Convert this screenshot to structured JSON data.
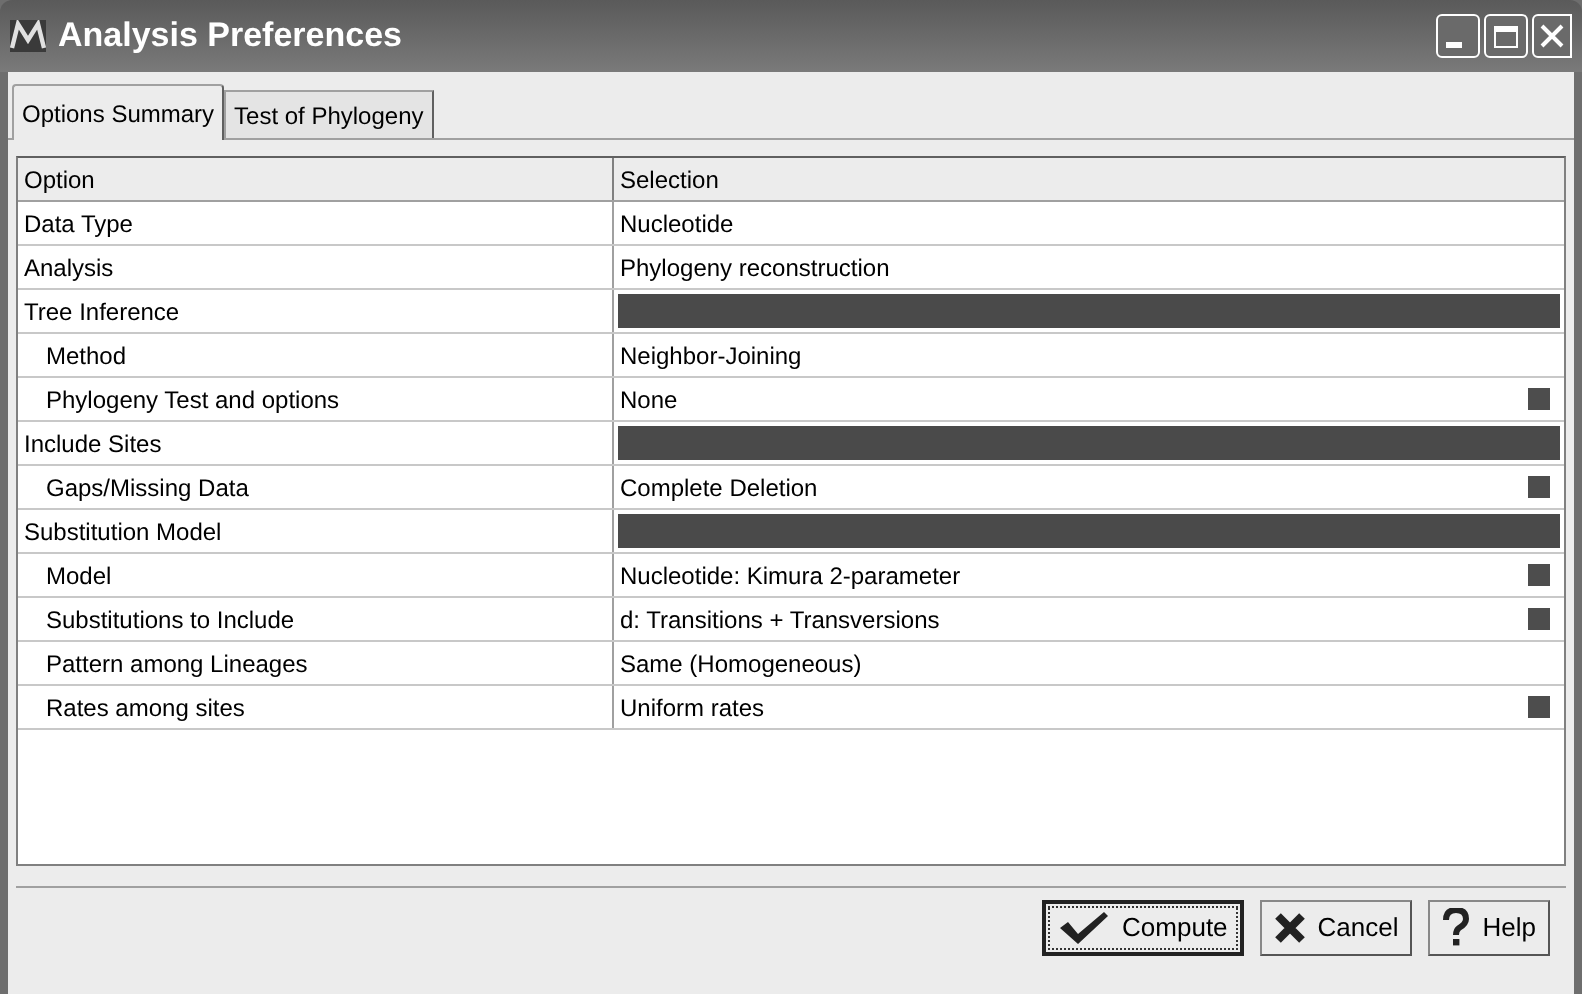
{
  "window": {
    "title": "Analysis Preferences"
  },
  "tabs": [
    {
      "label": "Options Summary",
      "selected": true
    },
    {
      "label": "Test of Phylogeny",
      "selected": false
    }
  ],
  "table": {
    "columns": [
      "Option",
      "Selection"
    ],
    "rows": [
      {
        "kind": "item",
        "option": "Data Type",
        "selection": "Nucleotide",
        "has_options": false
      },
      {
        "kind": "item",
        "option": "Analysis",
        "selection": "Phylogeny reconstruction",
        "has_options": false
      },
      {
        "kind": "section",
        "option": "Tree Inference",
        "children": [
          {
            "kind": "item",
            "option": "Method",
            "selection": "Neighbor-Joining",
            "has_options": false
          },
          {
            "kind": "item",
            "option": "Phylogeny Test and options",
            "selection": "None",
            "has_options": true
          }
        ]
      },
      {
        "kind": "section",
        "option": "Include Sites",
        "children": [
          {
            "kind": "item",
            "option": "Gaps/Missing Data",
            "selection": "Complete Deletion",
            "has_options": true
          }
        ]
      },
      {
        "kind": "section",
        "option": "Substitution Model",
        "children": [
          {
            "kind": "item",
            "option": "Model",
            "selection": "Nucleotide: Kimura 2-parameter",
            "has_options": true
          },
          {
            "kind": "item",
            "option": "Substitutions to Include",
            "selection": "d: Transitions + Transversions",
            "has_options": true
          },
          {
            "kind": "item",
            "option": "Pattern among Lineages",
            "selection": "Same (Homogeneous)",
            "has_options": false
          },
          {
            "kind": "item",
            "option": "Rates among sites",
            "selection": "Uniform rates",
            "has_options": true
          }
        ]
      }
    ]
  },
  "buttons": [
    {
      "kind": "compute",
      "label": "Compute",
      "default": true
    },
    {
      "kind": "cancel",
      "label": "Cancel",
      "default": false
    },
    {
      "kind": "help",
      "label": "Help",
      "default": false
    }
  ]
}
